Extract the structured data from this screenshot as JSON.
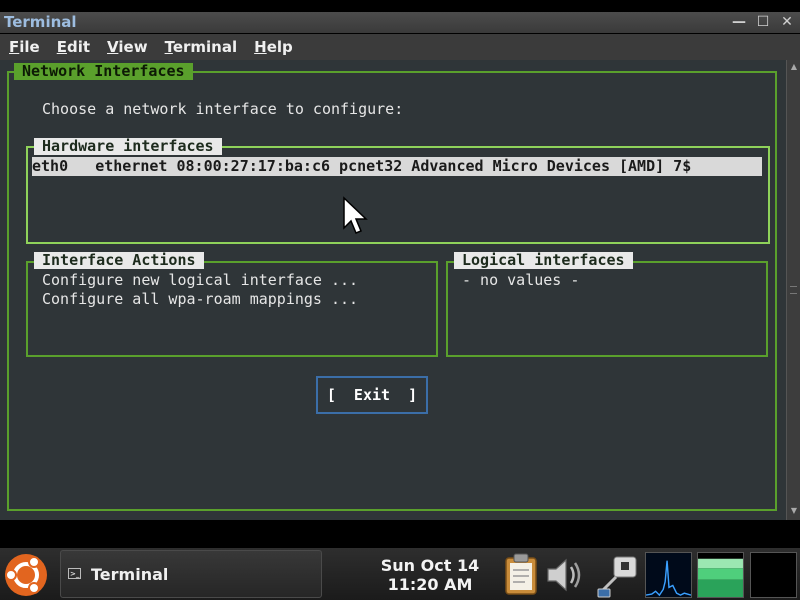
{
  "window": {
    "title": "Terminal",
    "controls": {
      "minimize": "—",
      "maximize": "☐",
      "close": "✕"
    }
  },
  "menubar": {
    "items": [
      {
        "hot": "F",
        "rest": "ile"
      },
      {
        "hot": "E",
        "rest": "dit"
      },
      {
        "hot": "V",
        "rest": "iew"
      },
      {
        "hot": "T",
        "rest": "erminal"
      },
      {
        "hot": "H",
        "rest": "elp"
      }
    ]
  },
  "dialog": {
    "title": "Network Interfaces",
    "prompt": "Choose a network interface to configure:",
    "hardware": {
      "title": "Hardware interfaces",
      "rows": [
        "eth0   ethernet 08:00:27:17:ba:c6 pcnet32 Advanced Micro Devices [AMD] 7$"
      ]
    },
    "actions": {
      "title": "Interface Actions",
      "items": [
        "Configure new logical interface ...",
        "Configure all wpa-roam mappings ..."
      ]
    },
    "logical": {
      "title": "Logical interfaces",
      "empty": "- no values -"
    },
    "exit_label": "[  Exit  ]"
  },
  "colors": {
    "terminal_bg": "#2f3538",
    "frame_green": "#5aa02c",
    "selected_frame": "#8fd25a",
    "exit_border": "#3b6ea8",
    "title_text": "#9dbde0"
  },
  "taskbar": {
    "logo_icon": "ubuntu-logo-icon",
    "task_label": "Terminal",
    "clock_day": "Sun Oct 14",
    "clock_time": "11:20 AM",
    "tray_icons": [
      "clipboard-icon",
      "volume-icon",
      "network-icon"
    ]
  }
}
